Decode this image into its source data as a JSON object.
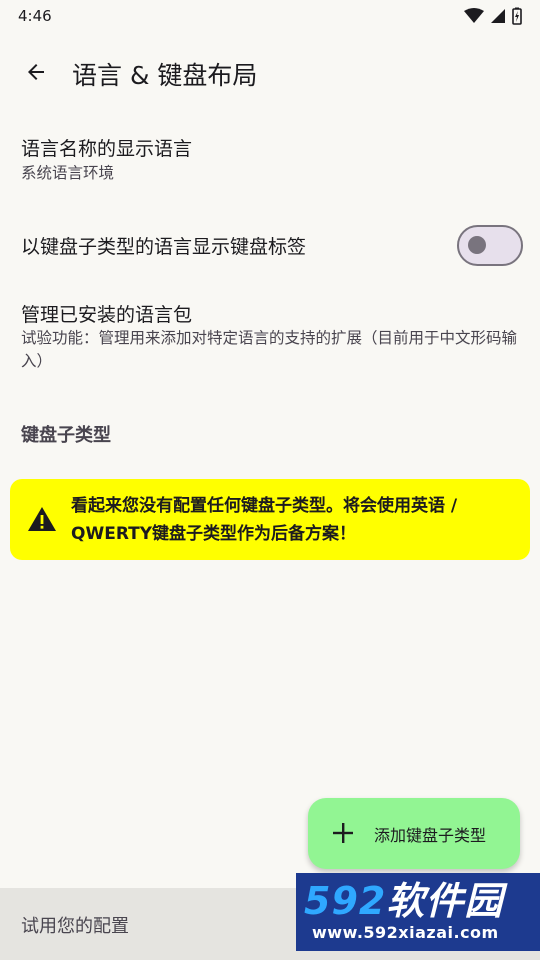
{
  "status_bar": {
    "time": "4:46"
  },
  "app_bar": {
    "title": "语言 & 键盘布局"
  },
  "preferences": [
    {
      "title": "语言名称的显示语言",
      "summary": "系统语言环境"
    },
    {
      "title": "以键盘子类型的语言显示键盘标签",
      "toggle_on": false
    },
    {
      "title": "管理已安装的语言包",
      "summary": "试验功能：管理用来添加对特定语言的支持的扩展（目前用于中文形码输入）"
    }
  ],
  "section_header": "键盘子类型",
  "warning": {
    "text": "看起来您没有配置任何键盘子类型。将会使用英语 / QWERTY键盘子类型作为后备方案！",
    "color": "#ffff00"
  },
  "fab": {
    "label": "添加键盘子类型",
    "color": "#92f593"
  },
  "bottom_bar": {
    "label": "试用您的配置"
  },
  "watermark": {
    "brand_digits": "592",
    "brand_text": "软件园",
    "url": "www.592xiazai.com"
  }
}
